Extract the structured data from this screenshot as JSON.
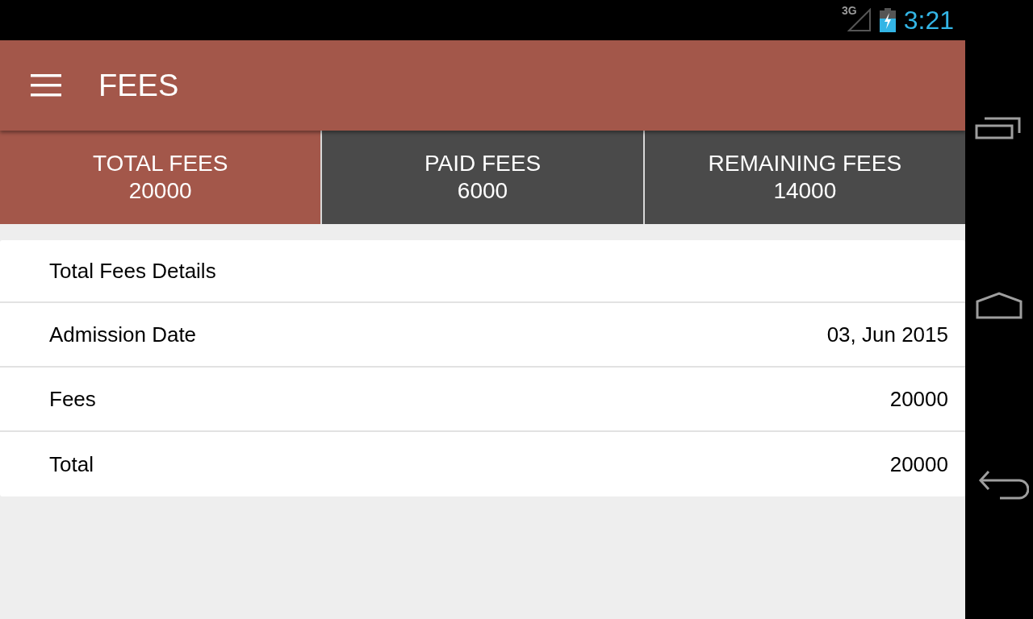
{
  "status_bar": {
    "network": "3G",
    "time": "3:21"
  },
  "app_bar": {
    "title": "FEES"
  },
  "tabs": [
    {
      "label": "TOTAL FEES",
      "value": "20000",
      "selected": true
    },
    {
      "label": "PAID FEES",
      "value": "6000",
      "selected": false
    },
    {
      "label": "REMAINING FEES",
      "value": "14000",
      "selected": false
    }
  ],
  "card": {
    "title": "Total Fees Details",
    "rows": [
      {
        "label": "Admission Date",
        "value": "03, Jun 2015"
      },
      {
        "label": "Fees",
        "value": "20000"
      },
      {
        "label": "Total",
        "value": "20000"
      }
    ]
  }
}
